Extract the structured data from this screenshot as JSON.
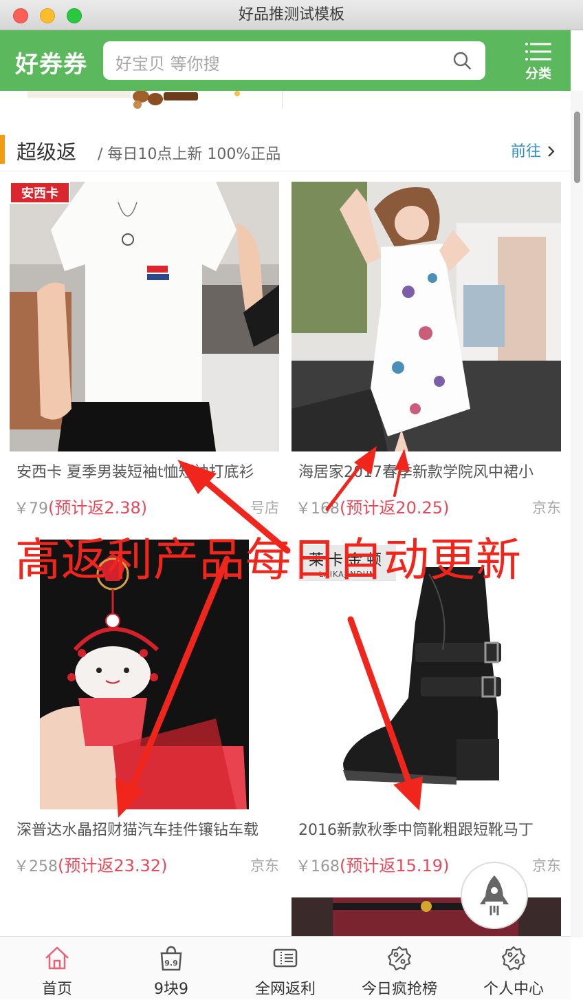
{
  "window": {
    "title": "好品推测试模板"
  },
  "header": {
    "brand": "好券券",
    "search_placeholder": "好宝贝 等你搜",
    "menu_label": "分类"
  },
  "section": {
    "title": "超级返",
    "subtitle": "/ 每日10点上新 100%正品",
    "link": "前往"
  },
  "products": [
    {
      "name": "安西卡 夏季男装短袖t恤短袖打底衫",
      "price": "￥79",
      "rebate": "(预计返2.38)",
      "shop": "号店",
      "logo": "安西卡",
      "image": "white-tshirt-photo"
    },
    {
      "name": "海居家2017春季新款学院风中裙小",
      "price": "￥168",
      "rebate": "(预计返20.25)",
      "shop": "京东",
      "image": "white-dress-photo"
    },
    {
      "name": "深普达水晶招财猫汽车挂件镶钻车载",
      "price": "￥258",
      "rebate": "(预计返23.32)",
      "shop": "京东",
      "image": "lucky-cat-pendant-photo"
    },
    {
      "name": "2016新款秋季中筒靴粗跟短靴马丁",
      "price": "￥168",
      "rebate": "(预计返15.19)",
      "shop": "京东",
      "logo": "莱卡金顿",
      "logo_sub": "LAIKAJINDUN",
      "image": "black-boot-photo"
    }
  ],
  "annotation": {
    "text": "高返利产品每日自动更新",
    "color": "#f0261d"
  },
  "tabs": [
    {
      "label": "首页",
      "icon": "home-icon",
      "active": true
    },
    {
      "label": "9块9",
      "icon": "bag-9.9-icon"
    },
    {
      "label": "全网返利",
      "icon": "ticket-icon"
    },
    {
      "label": "今日疯抢榜",
      "icon": "percent-badge-icon"
    },
    {
      "label": "个人中心",
      "icon": "percent-badge-icon"
    }
  ],
  "colors": {
    "theme_green": "#5cb85c",
    "accent_orange": "#f39c12",
    "rebate_red": "#e54a5b",
    "link_blue": "#2e8bc0",
    "home_tab_pink": "#e8637a"
  }
}
